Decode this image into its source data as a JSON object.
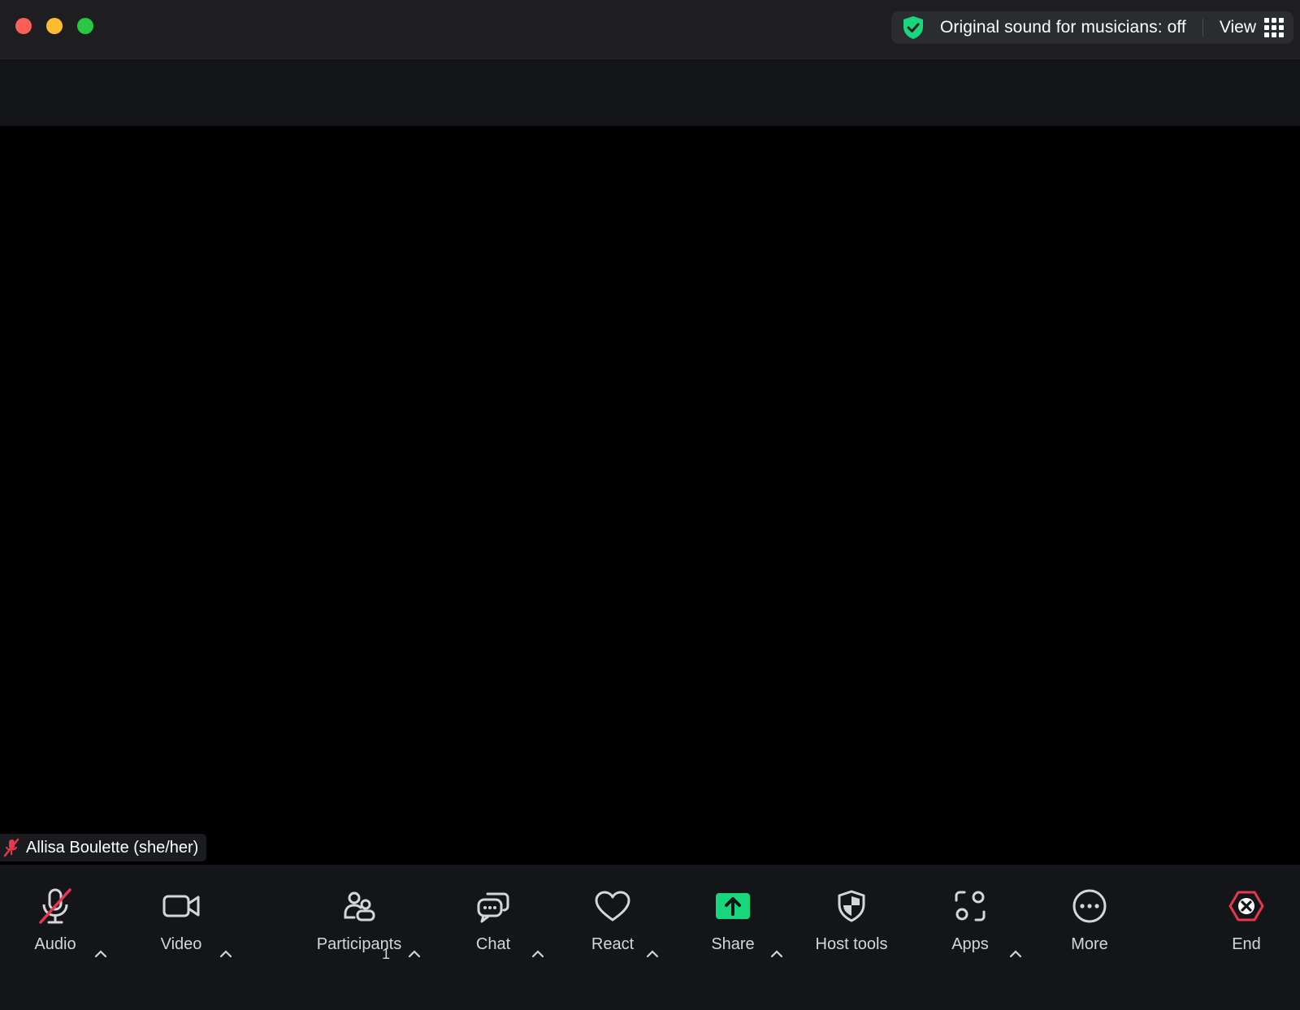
{
  "titlebar": {
    "sound_status": "Original sound for musicians: off",
    "view_label": "View"
  },
  "video": {
    "participant_name": "Allisa Boulette (she/her)"
  },
  "toolbar": {
    "audio_label": "Audio",
    "video_label": "Video",
    "participants_label": "Participants",
    "participants_count": "1",
    "chat_label": "Chat",
    "react_label": "React",
    "share_label": "Share",
    "host_tools_label": "Host tools",
    "apps_label": "Apps",
    "more_label": "More",
    "end_label": "End"
  },
  "colors": {
    "accent_green": "#18d67c",
    "end_red": "#e8384f",
    "muted_red": "#e8384f"
  },
  "icons": [
    "shield-check-icon",
    "grid-icon",
    "mic-off-icon",
    "camera-icon",
    "participants-icon",
    "chat-icon",
    "heart-icon",
    "share-up-arrow-icon",
    "shield-icon",
    "apps-icon",
    "more-dots-icon",
    "end-x-icon",
    "chevron-up-icon"
  ]
}
